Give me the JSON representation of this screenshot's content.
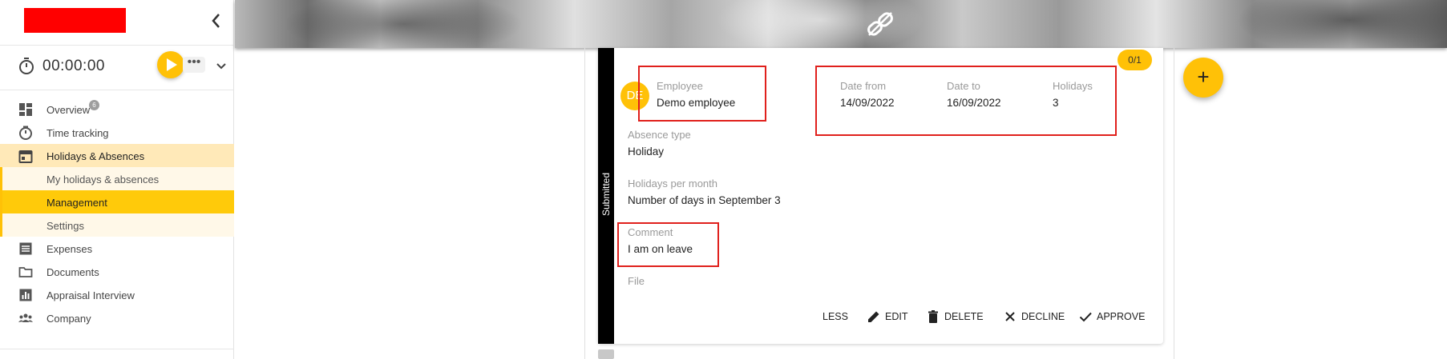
{
  "sidebar": {
    "timer": {
      "value": "00:00:00",
      "more_label": "•••"
    },
    "items": [
      {
        "label": "Overview",
        "icon": "dashboard-icon",
        "badge": "6"
      },
      {
        "label": "Time tracking",
        "icon": "stopwatch-icon"
      },
      {
        "label": "Holidays & Absences",
        "icon": "calendar-icon"
      },
      {
        "label": "My holidays & absences"
      },
      {
        "label": "Management"
      },
      {
        "label": "Settings"
      },
      {
        "label": "Expenses",
        "icon": "list-icon"
      },
      {
        "label": "Documents",
        "icon": "folder-icon"
      },
      {
        "label": "Appraisal Interview",
        "icon": "bar-chart-icon"
      },
      {
        "label": "Company",
        "icon": "people-icon"
      }
    ]
  },
  "card": {
    "status": "Submitted",
    "count": "0/1",
    "avatar_initials": "DE",
    "employee": {
      "label": "Employee",
      "value": "Demo employee"
    },
    "date_from": {
      "label": "Date from",
      "value": "14/09/2022"
    },
    "date_to": {
      "label": "Date to",
      "value": "16/09/2022"
    },
    "holidays": {
      "label": "Holidays",
      "value": "3"
    },
    "absence_type": {
      "label": "Absence type",
      "value": "Holiday"
    },
    "holidays_per_month": {
      "label": "Holidays per month",
      "value": "Number of days in September 3"
    },
    "comment": {
      "label": "Comment",
      "value": "I am on leave"
    },
    "file": {
      "label": "File"
    },
    "actions": {
      "less": "LESS",
      "edit": "EDIT",
      "delete": "DELETE",
      "decline": "DECLINE",
      "approve": "APPROVE"
    }
  },
  "fab_label": "+",
  "colors": {
    "accent": "#ffc107",
    "status_bar": "#000000",
    "highlight_box": "#e0201c",
    "logo_redaction": "#ff0000"
  }
}
